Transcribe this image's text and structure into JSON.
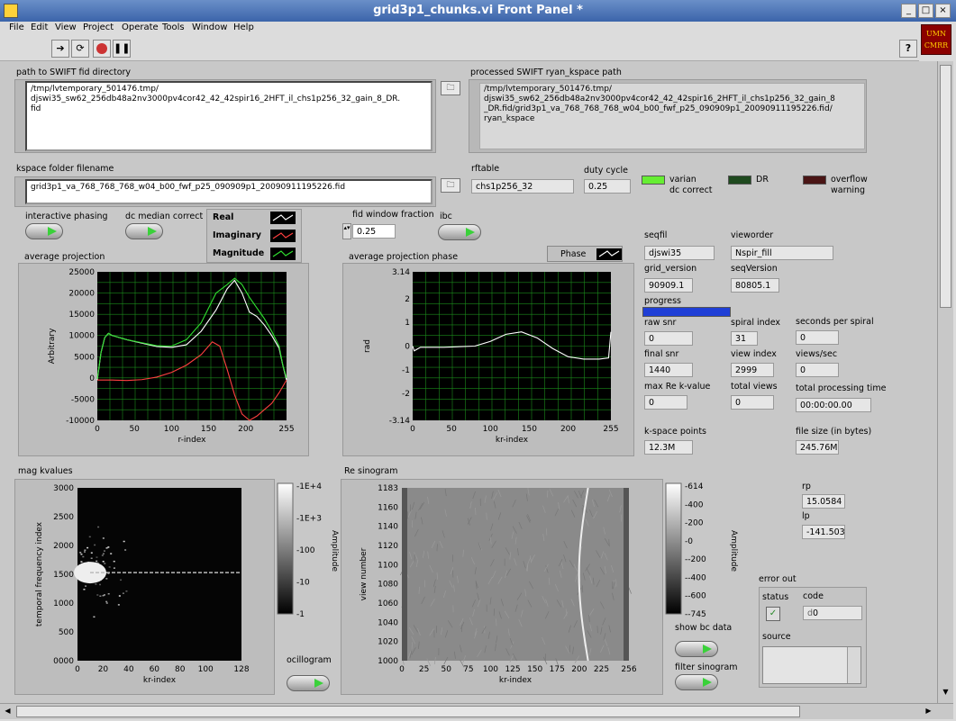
{
  "window": {
    "title": "grid3p1_chunks.vi Front Panel *",
    "min": "_",
    "max": "□",
    "close": "×"
  },
  "menu": [
    "File",
    "Edit",
    "View",
    "Project",
    "Operate",
    "Tools",
    "Window",
    "Help"
  ],
  "logo": {
    "l1": "UMN",
    "l2": "CMRR"
  },
  "help": "?",
  "paths": {
    "fid_label": "path to SWIFT fid directory",
    "fid_value": "/tmp/lvtemporary_501476.tmp/\ndjswi35_sw62_256db48a2nv3000pv4cor42_42_42spir16_2HFT_il_chs1p256_32_gain_8_DR.\nfid",
    "kspace_label": "processed SWIFT ryan_kspace path",
    "kspace_value": "/tmp/lvtemporary_501476.tmp/\ndjswi35_sw62_256db48a2nv3000pv4cor42_42_42spir16_2HFT_il_chs1p256_32_gain_8\n_DR.fid/grid3p1_va_768_768_768_w04_b00_fwf_p25_090909p1_20090911195226.fid/\nryan_kspace",
    "folder_label": "kspace folder filename",
    "folder_value": "grid3p1_va_768_768_768_w04_b00_fwf_p25_090909p1_20090911195226.fid"
  },
  "rftable": {
    "label": "rftable",
    "value": "chs1p256_32"
  },
  "duty": {
    "label": "duty cycle",
    "value": "0.25"
  },
  "leds": {
    "varian": "varian\ndc correct",
    "dr": "DR",
    "overflow": "overflow\nwarning",
    "varian_color": "#66ee33",
    "dr_color": "#1f4a1f",
    "overflow_color": "#4a1515"
  },
  "buttons": {
    "interactive": "interactive phasing",
    "median": "dc median correct",
    "ibc": "ibc",
    "showbc": "show bc data",
    "filter": "filter sinogram",
    "ocillogram": "ocillogram"
  },
  "legend": {
    "real": "Real",
    "imag": "Imaginary",
    "mag": "Magnitude",
    "phase": "Phase"
  },
  "fidwindow": {
    "label": "fid window fraction",
    "value": "0.25"
  },
  "fields": {
    "seqfil": {
      "label": "seqfil",
      "value": "djswi35"
    },
    "vieworder": {
      "label": "vieworder",
      "value": "Nspir_fill"
    },
    "grid_version": {
      "label": "grid_version",
      "value": "90909.1"
    },
    "seqVersion": {
      "label": "seqVersion",
      "value": "80805.1"
    },
    "progress": {
      "label": "progress",
      "value": 1.0
    },
    "raw_snr": {
      "label": "raw snr",
      "value": "0"
    },
    "spiral_index": {
      "label": "spiral index",
      "value": "31"
    },
    "sec_per_spiral": {
      "label": "seconds per spiral",
      "value": "0"
    },
    "final_snr": {
      "label": "final snr",
      "value": "1440"
    },
    "view_index": {
      "label": "view index",
      "value": "2999"
    },
    "views_sec": {
      "label": "views/sec",
      "value": "0"
    },
    "max_re": {
      "label": "max Re k-value",
      "value": "0"
    },
    "total_views": {
      "label": "total views",
      "value": "0"
    },
    "total_time": {
      "label": "total processing time",
      "value": "00:00:00.00"
    },
    "kpoints": {
      "label": "k-space points",
      "value": "12.3M"
    },
    "filesize": {
      "label": "file size (in bytes)",
      "value": "245.76M"
    },
    "rp": {
      "label": "rp",
      "value": "15.0584"
    },
    "lp": {
      "label": "lp",
      "value": "-141.503"
    }
  },
  "error": {
    "label": "error out",
    "status": "status",
    "code": "code",
    "code_value": "0",
    "code_prefix": "d",
    "source": "source",
    "check": "✓"
  },
  "chart_data": [
    {
      "type": "line",
      "title": "average projection",
      "xlabel": "r-index",
      "ylabel": "Arbitrary",
      "xticks": [
        "0",
        "50",
        "100",
        "150",
        "200",
        "255"
      ],
      "yticks": [
        "25000",
        "20000",
        "15000",
        "10000",
        "5000",
        "0",
        "-5000",
        "-10000"
      ],
      "xlim": [
        0,
        255
      ],
      "ylim": [
        -10000,
        25000
      ],
      "series": [
        {
          "name": "Real",
          "color": "#ffffff",
          "x": [
            0,
            5,
            10,
            15,
            20,
            40,
            60,
            80,
            100,
            120,
            140,
            160,
            175,
            185,
            195,
            205,
            215,
            225,
            235,
            245,
            250,
            255
          ],
          "y": [
            -500,
            6000,
            9500,
            10500,
            10000,
            9000,
            8200,
            7400,
            7200,
            7800,
            11000,
            16000,
            21000,
            23000,
            20000,
            15500,
            14500,
            12500,
            10000,
            7000,
            3000,
            -500
          ]
        },
        {
          "name": "Imaginary",
          "color": "#ff4040",
          "x": [
            0,
            5,
            20,
            40,
            60,
            80,
            100,
            120,
            140,
            155,
            165,
            175,
            185,
            195,
            205,
            215,
            225,
            235,
            245,
            255
          ],
          "y": [
            -500,
            -500,
            -500,
            -600,
            -400,
            200,
            1300,
            3000,
            5500,
            8500,
            7500,
            2000,
            -4000,
            -8500,
            -10000,
            -9000,
            -7500,
            -6000,
            -3500,
            -500
          ]
        },
        {
          "name": "Magnitude",
          "color": "#30e030",
          "x": [
            0,
            5,
            10,
            15,
            20,
            40,
            60,
            80,
            100,
            120,
            140,
            160,
            175,
            185,
            195,
            205,
            215,
            225,
            235,
            245,
            250,
            255
          ],
          "y": [
            -200,
            6000,
            9500,
            10500,
            10000,
            9000,
            8300,
            7600,
            7500,
            9000,
            13000,
            20000,
            22000,
            23500,
            22000,
            19000,
            16500,
            14000,
            11000,
            7500,
            3000,
            0
          ]
        }
      ]
    },
    {
      "type": "line",
      "title": "average projection phase",
      "xlabel": "kr-index",
      "ylabel": "rad",
      "xticks": [
        "0",
        "50",
        "100",
        "150",
        "200",
        "255"
      ],
      "yticks": [
        "3.14",
        "2",
        "1",
        "0",
        "-1",
        "-2",
        "-3.14"
      ],
      "xlim": [
        0,
        255
      ],
      "ylim": [
        -3.14,
        3.14
      ],
      "series": [
        {
          "name": "Phase",
          "color": "#ffffff",
          "x": [
            0,
            2,
            10,
            40,
            80,
            100,
            120,
            140,
            160,
            180,
            200,
            220,
            240,
            252,
            255
          ],
          "y": [
            0,
            -0.2,
            -0.05,
            -0.05,
            0,
            0.2,
            0.5,
            0.6,
            0.35,
            -0.1,
            -0.45,
            -0.55,
            -0.55,
            -0.5,
            0.6
          ]
        }
      ]
    },
    {
      "type": "heatmap",
      "title": "mag kvalues",
      "xlabel": "kr-index",
      "ylabel": "temporal frequency index",
      "zlabel": "Amplitude",
      "xticks": [
        "0",
        "20",
        "40",
        "60",
        "80",
        "100",
        "128"
      ],
      "yticks": [
        "3000",
        "2500",
        "2000",
        "1500",
        "1000",
        "500",
        "0000"
      ],
      "zticks": [
        "1E+4",
        "1E+3",
        "100",
        "10",
        "1"
      ]
    },
    {
      "type": "heatmap",
      "title": "Re sinogram",
      "xlabel": "kr-index",
      "ylabel": "view number",
      "zlabel": "Amplitude",
      "xticks": [
        "0",
        "25",
        "50",
        "75",
        "100",
        "125",
        "150",
        "175",
        "200",
        "225",
        "256"
      ],
      "yticks": [
        "1183",
        "1160",
        "1140",
        "1120",
        "1100",
        "1080",
        "1060",
        "1040",
        "1020",
        "1000"
      ],
      "zticks": [
        "614",
        "400",
        "200",
        "0",
        "-200",
        "-400",
        "-600",
        "-745"
      ]
    }
  ]
}
